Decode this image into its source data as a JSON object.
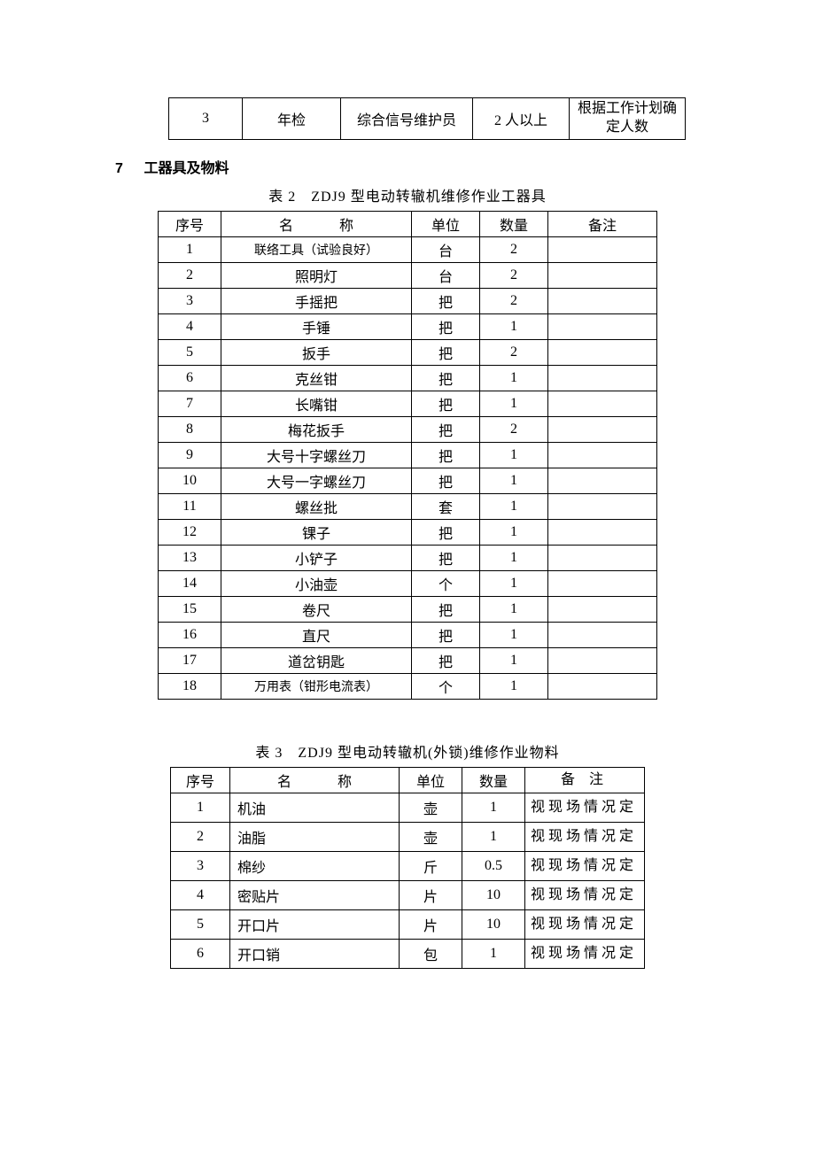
{
  "table1": {
    "row": {
      "num": "3",
      "type": "年检",
      "role": "综合信号维护员",
      "people": "2 人以上",
      "note": "根据工作计划确定人数"
    }
  },
  "section7": {
    "num": "7",
    "title": "工器具及物料"
  },
  "table2": {
    "caption": "表 2　ZDJ9 型电动转辙机维修作业工器具",
    "headers": {
      "num": "序号",
      "name": "名　称",
      "unit": "单位",
      "qty": "数量",
      "note": "备注"
    },
    "rows": [
      {
        "num": "1",
        "name": "联络工具（试验良好）",
        "unit": "台",
        "qty": "2",
        "note": ""
      },
      {
        "num": "2",
        "name": "照明灯",
        "unit": "台",
        "qty": "2",
        "note": ""
      },
      {
        "num": "3",
        "name": "手摇把",
        "unit": "把",
        "qty": "2",
        "note": ""
      },
      {
        "num": "4",
        "name": "手锤",
        "unit": "把",
        "qty": "1",
        "note": ""
      },
      {
        "num": "5",
        "name": "扳手",
        "unit": "把",
        "qty": "2",
        "note": ""
      },
      {
        "num": "6",
        "name": "克丝钳",
        "unit": "把",
        "qty": "1",
        "note": ""
      },
      {
        "num": "7",
        "name": "长嘴钳",
        "unit": "把",
        "qty": "1",
        "note": ""
      },
      {
        "num": "8",
        "name": "梅花扳手",
        "unit": "把",
        "qty": "2",
        "note": ""
      },
      {
        "num": "9",
        "name": "大号十字螺丝刀",
        "unit": "把",
        "qty": "1",
        "note": ""
      },
      {
        "num": "10",
        "name": "大号一字螺丝刀",
        "unit": "把",
        "qty": "1",
        "note": ""
      },
      {
        "num": "11",
        "name": "螺丝批",
        "unit": "套",
        "qty": "1",
        "note": ""
      },
      {
        "num": "12",
        "name": "锞子",
        "unit": "把",
        "qty": "1",
        "note": ""
      },
      {
        "num": "13",
        "name": "小铲子",
        "unit": "把",
        "qty": "1",
        "note": ""
      },
      {
        "num": "14",
        "name": "小油壶",
        "unit": "个",
        "qty": "1",
        "note": ""
      },
      {
        "num": "15",
        "name": "卷尺",
        "unit": "把",
        "qty": "1",
        "note": ""
      },
      {
        "num": "16",
        "name": "直尺",
        "unit": "把",
        "qty": "1",
        "note": ""
      },
      {
        "num": "17",
        "name": "道岔钥匙",
        "unit": "把",
        "qty": "1",
        "note": ""
      },
      {
        "num": "18",
        "name": "万用表（钳形电流表）",
        "unit": "个",
        "qty": "1",
        "note": ""
      }
    ]
  },
  "table3": {
    "caption": "表 3　ZDJ9 型电动转辙机(外锁)维修作业物料",
    "headers": {
      "num": "序号",
      "name": "名　称",
      "unit": "单位",
      "qty": "数量",
      "note": "备 注"
    },
    "rows": [
      {
        "num": "1",
        "name": "机油",
        "unit": "壶",
        "qty": "1",
        "note": "视现场情况定"
      },
      {
        "num": "2",
        "name": "油脂",
        "unit": "壶",
        "qty": "1",
        "note": "视现场情况定"
      },
      {
        "num": "3",
        "name": "棉纱",
        "unit": "斤",
        "qty": "0.5",
        "note": "视现场情况定"
      },
      {
        "num": "4",
        "name": "密贴片",
        "unit": "片",
        "qty": "10",
        "note": "视现场情况定"
      },
      {
        "num": "5",
        "name": "开口片",
        "unit": "片",
        "qty": "10",
        "note": "视现场情况定"
      },
      {
        "num": "6",
        "name": "开口销",
        "unit": "包",
        "qty": "1",
        "note": "视现场情况定"
      }
    ]
  }
}
